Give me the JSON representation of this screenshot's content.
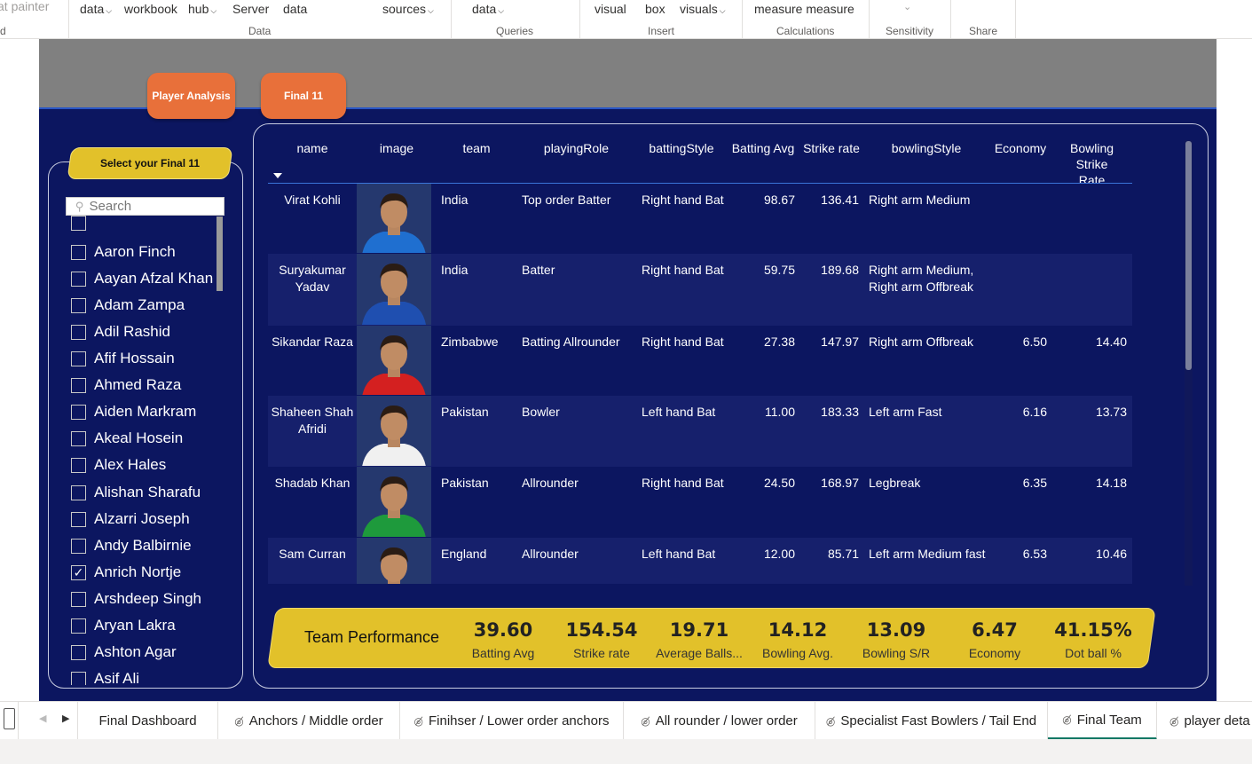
{
  "ribbon": {
    "items": [
      "at painter",
      "data",
      "workbook",
      "hub",
      "Server",
      "data",
      "sources",
      "data",
      "visual",
      "box",
      "visuals",
      "measure measure"
    ],
    "left_fragment": "d",
    "groups": [
      "Data",
      "Queries",
      "Insert",
      "Calculations",
      "Sensitivity",
      "Share"
    ]
  },
  "nav": {
    "player_analysis": "Player Analysis",
    "final11": "Final 11"
  },
  "slicer": {
    "title": "Select your Final 11",
    "search_placeholder": "Search",
    "items": [
      {
        "label": "",
        "checked": false
      },
      {
        "label": "Aaron Finch",
        "checked": false
      },
      {
        "label": "Aayan Afzal Khan",
        "checked": false
      },
      {
        "label": "Adam Zampa",
        "checked": false
      },
      {
        "label": "Adil Rashid",
        "checked": false
      },
      {
        "label": "Afif Hossain",
        "checked": false
      },
      {
        "label": "Ahmed Raza",
        "checked": false
      },
      {
        "label": "Aiden Markram",
        "checked": false
      },
      {
        "label": "Akeal Hosein",
        "checked": false
      },
      {
        "label": "Alex Hales",
        "checked": false
      },
      {
        "label": "Alishan Sharafu",
        "checked": false
      },
      {
        "label": "Alzarri Joseph",
        "checked": false
      },
      {
        "label": "Andy Balbirnie",
        "checked": false
      },
      {
        "label": "Anrich Nortje",
        "checked": true
      },
      {
        "label": "Arshdeep Singh",
        "checked": false
      },
      {
        "label": "Aryan Lakra",
        "checked": false
      },
      {
        "label": "Ashton Agar",
        "checked": false
      },
      {
        "label": "Asif Ali",
        "checked": false
      }
    ]
  },
  "table": {
    "headers": {
      "name": "name",
      "image": "image",
      "team": "team",
      "playingRole": "playingRole",
      "battingStyle": "battingStyle",
      "battingAvg": "Batting Avg",
      "strikeRate": "Strike rate",
      "bowlingStyle": "bowlingStyle",
      "economy": "Economy",
      "bowlingSR": "Bowling Strike Rate"
    },
    "rows": [
      {
        "name": "Virat Kohli",
        "team": "India",
        "role": "Top order Batter",
        "bat": "Right hand Bat",
        "avg": "98.67",
        "sr": "136.41",
        "bowl": "Right arm Medium",
        "eco": "",
        "bsr": "",
        "shirt": "#1f6fd0"
      },
      {
        "name": "Suryakumar Yadav",
        "team": "India",
        "role": "Batter",
        "bat": "Right hand Bat",
        "avg": "59.75",
        "sr": "189.68",
        "bowl": "Right arm Medium, Right arm Offbreak",
        "eco": "",
        "bsr": "",
        "shirt": "#1f4fb0"
      },
      {
        "name": "Sikandar Raza",
        "team": "Zimbabwe",
        "role": "Batting Allrounder",
        "bat": "Right hand Bat",
        "avg": "27.38",
        "sr": "147.97",
        "bowl": "Right arm Offbreak",
        "eco": "6.50",
        "bsr": "14.40",
        "shirt": "#d42020"
      },
      {
        "name": "Shaheen Shah Afridi",
        "team": "Pakistan",
        "role": "Bowler",
        "bat": "Left hand Bat",
        "avg": "11.00",
        "sr": "183.33",
        "bowl": "Left arm Fast",
        "eco": "6.16",
        "bsr": "13.73",
        "shirt": "#f0f0f0"
      },
      {
        "name": "Shadab Khan",
        "team": "Pakistan",
        "role": "Allrounder",
        "bat": "Right hand Bat",
        "avg": "24.50",
        "sr": "168.97",
        "bowl": "Legbreak",
        "eco": "6.35",
        "bsr": "14.18",
        "shirt": "#1e9a3c"
      },
      {
        "name": "Sam Curran",
        "team": "England",
        "role": "Allrounder",
        "bat": "Left hand Bat",
        "avg": "12.00",
        "sr": "85.71",
        "bowl": "Left arm Medium fast",
        "eco": "6.53",
        "bsr": "10.46",
        "shirt": "#f4f4f4"
      }
    ]
  },
  "performance": {
    "title": "Team Performance",
    "kpis": [
      {
        "value": "39.60",
        "label": "Batting Avg"
      },
      {
        "value": "154.54",
        "label": "Strike rate"
      },
      {
        "value": "19.71",
        "label": "Average Balls..."
      },
      {
        "value": "14.12",
        "label": "Bowling Avg."
      },
      {
        "value": "13.09",
        "label": "Bowling S/R"
      },
      {
        "value": "6.47",
        "label": "Economy"
      },
      {
        "value": "41.15%",
        "label": "Dot ball %"
      }
    ]
  },
  "tabs": [
    {
      "label": "Final Dashboard",
      "hidden": false,
      "active": false
    },
    {
      "label": "Anchors / Middle order",
      "hidden": true,
      "active": false
    },
    {
      "label": "Finihser / Lower order anchors",
      "hidden": true,
      "active": false
    },
    {
      "label": "All rounder / lower order",
      "hidden": true,
      "active": false
    },
    {
      "label": "Specialist Fast Bowlers / Tail End",
      "hidden": true,
      "active": false
    },
    {
      "label": "Final Team",
      "hidden": true,
      "active": true
    },
    {
      "label": "player deta",
      "hidden": true,
      "active": false
    }
  ],
  "colors": {
    "canvas": "#0c1660",
    "accent_yellow": "#e2c12a",
    "nav_orange": "#e8703a",
    "row_a": "#0c1660",
    "row_b": "#16206c",
    "active_tab": "#117865"
  },
  "icons": {
    "hidden_page": "eye-slash-icon",
    "mobile": "phone-icon",
    "prev": "chevron-left-icon",
    "next": "chevron-right-icon",
    "check": "checkmark-icon",
    "search": "magnifier-icon"
  }
}
